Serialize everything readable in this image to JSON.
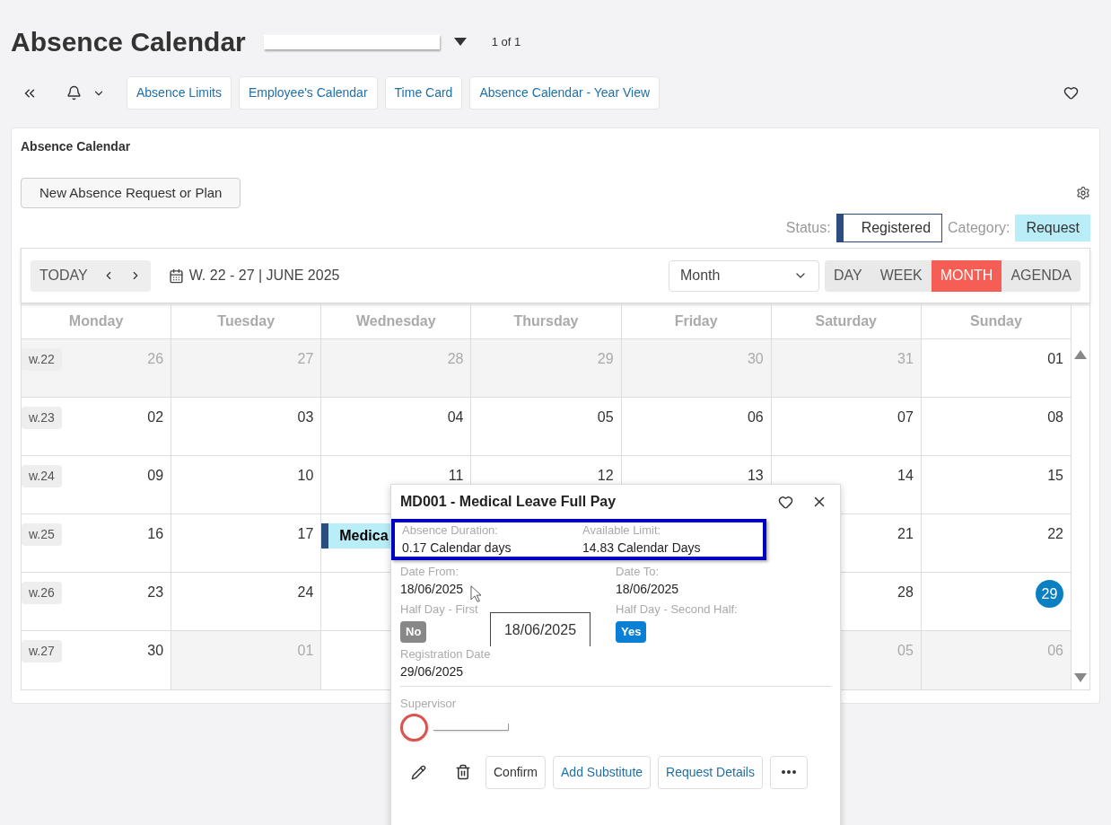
{
  "header": {
    "title": "Absence Calendar",
    "pager": "1 of 1"
  },
  "toolbar": {
    "links": [
      "Absence Limits",
      "Employee's Calendar",
      "Time Card",
      "Absence Calendar - Year View"
    ]
  },
  "card": {
    "title": "Absence Calendar",
    "new_button": "New Absence Request or Plan",
    "legend": [
      {
        "label": "Status:",
        "value": "Registered",
        "kind": "status"
      },
      {
        "label": "Category:",
        "value": "Request",
        "kind": "category"
      }
    ]
  },
  "calendar": {
    "today_button": "TODAY",
    "range": "W. 22 - 27 | JUNE 2025",
    "view_select": "Month",
    "views": [
      {
        "label": "DAY",
        "selected": false
      },
      {
        "label": "WEEK",
        "selected": false
      },
      {
        "label": "MONTH",
        "selected": true
      },
      {
        "label": "AGENDA",
        "selected": false
      }
    ],
    "weekdays": [
      "Monday",
      "Tuesday",
      "Wednesday",
      "Thursday",
      "Friday",
      "Saturday",
      "Sunday"
    ],
    "weeks": [
      {
        "week": "w.22",
        "days": [
          {
            "day": "26",
            "muted": true,
            "today": false
          },
          {
            "day": "27",
            "muted": true,
            "today": false
          },
          {
            "day": "28",
            "muted": true,
            "today": false
          },
          {
            "day": "29",
            "muted": true,
            "today": false
          },
          {
            "day": "30",
            "muted": true,
            "today": false
          },
          {
            "day": "31",
            "muted": true,
            "today": false
          },
          {
            "day": "01",
            "muted": false,
            "today": false
          }
        ]
      },
      {
        "week": "w.23",
        "days": [
          {
            "day": "02",
            "muted": false,
            "today": false
          },
          {
            "day": "03",
            "muted": false,
            "today": false
          },
          {
            "day": "04",
            "muted": false,
            "today": false
          },
          {
            "day": "05",
            "muted": false,
            "today": false
          },
          {
            "day": "06",
            "muted": false,
            "today": false
          },
          {
            "day": "07",
            "muted": false,
            "today": false
          },
          {
            "day": "08",
            "muted": false,
            "today": false
          }
        ]
      },
      {
        "week": "w.24",
        "days": [
          {
            "day": "09",
            "muted": false,
            "today": false
          },
          {
            "day": "10",
            "muted": false,
            "today": false
          },
          {
            "day": "11",
            "muted": false,
            "today": false
          },
          {
            "day": "12",
            "muted": false,
            "today": false
          },
          {
            "day": "13",
            "muted": false,
            "today": false
          },
          {
            "day": "14",
            "muted": false,
            "today": false
          },
          {
            "day": "15",
            "muted": false,
            "today": false
          }
        ]
      },
      {
        "week": "w.25",
        "days": [
          {
            "day": "16",
            "muted": false,
            "today": false
          },
          {
            "day": "17",
            "muted": false,
            "today": false
          },
          {
            "event": "Medica"
          },
          {
            "day": "21",
            "muted": false,
            "today": false
          },
          {
            "day": "22",
            "muted": false,
            "today": false
          }
        ]
      },
      {
        "week": "w.26",
        "days": [
          {
            "day": "23",
            "muted": false,
            "today": false
          },
          {
            "day": "24",
            "muted": false,
            "today": false
          },
          {
            "day": "28",
            "muted": false,
            "today": false
          },
          {
            "day": "29",
            "muted": false,
            "today": true
          }
        ]
      },
      {
        "week": "w.27",
        "days": [
          {
            "day": "30",
            "muted": false,
            "today": false
          },
          {
            "day": "01",
            "muted": true,
            "today": false
          },
          {
            "day": "05",
            "muted": true,
            "today": false
          },
          {
            "day": "06",
            "muted": true,
            "today": false
          }
        ]
      }
    ]
  },
  "popup": {
    "title": "MD001 - Medical Leave Full Pay",
    "rows": [
      {
        "highlighted": true,
        "fields": [
          {
            "label": "Absence Duration:",
            "value": "0.17 Calendar days",
            "kind": "text"
          },
          {
            "label": "Available Limit:",
            "value": "14.83 Calendar Days",
            "kind": "text"
          }
        ]
      },
      {
        "highlighted": false,
        "fields": [
          {
            "label": "Date From:",
            "value": "18/06/2025",
            "kind": "text"
          },
          {
            "label": "Date To:",
            "value": "18/06/2025",
            "kind": "text"
          }
        ]
      },
      {
        "highlighted": false,
        "fields": [
          {
            "label": "Half Day - First",
            "value": "No",
            "kind": "flag",
            "on": false
          },
          {
            "label": "Half Day - Second Half:",
            "value": "Yes",
            "kind": "flag",
            "on": true
          }
        ]
      },
      {
        "highlighted": false,
        "fields": [
          {
            "label": "Registration Date",
            "value": "29/06/2025",
            "kind": "text"
          }
        ]
      }
    ],
    "supervisor_label": "Supervisor",
    "tooltip": "18/06/2025",
    "actions": [
      {
        "label": "Confirm",
        "kind": "plain"
      },
      {
        "label": "Add Substitute",
        "kind": "link"
      },
      {
        "label": "Request Details",
        "kind": "link"
      }
    ]
  }
}
